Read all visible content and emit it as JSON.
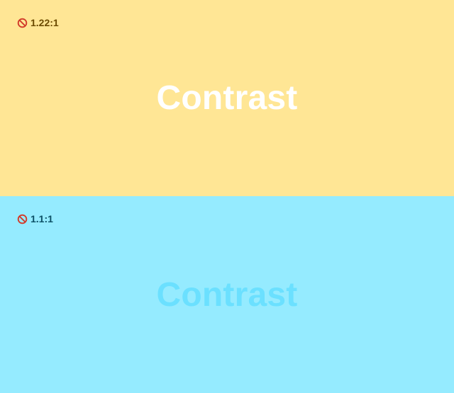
{
  "panels": [
    {
      "ratio_label": "1.22:1",
      "sample_text": "Contrast",
      "status_icon": "prohibited-icon",
      "background_color": "#FFE695",
      "sample_color": "#FFFFFF",
      "ratio_color": "#6B4A00"
    },
    {
      "ratio_label": "1.1:1",
      "sample_text": "Contrast",
      "status_icon": "prohibited-icon",
      "background_color": "#95EBFF",
      "sample_color": "#6BE0FF",
      "ratio_color": "#0C5066"
    }
  ],
  "colors": {
    "fail_icon": "#D23A2A"
  }
}
